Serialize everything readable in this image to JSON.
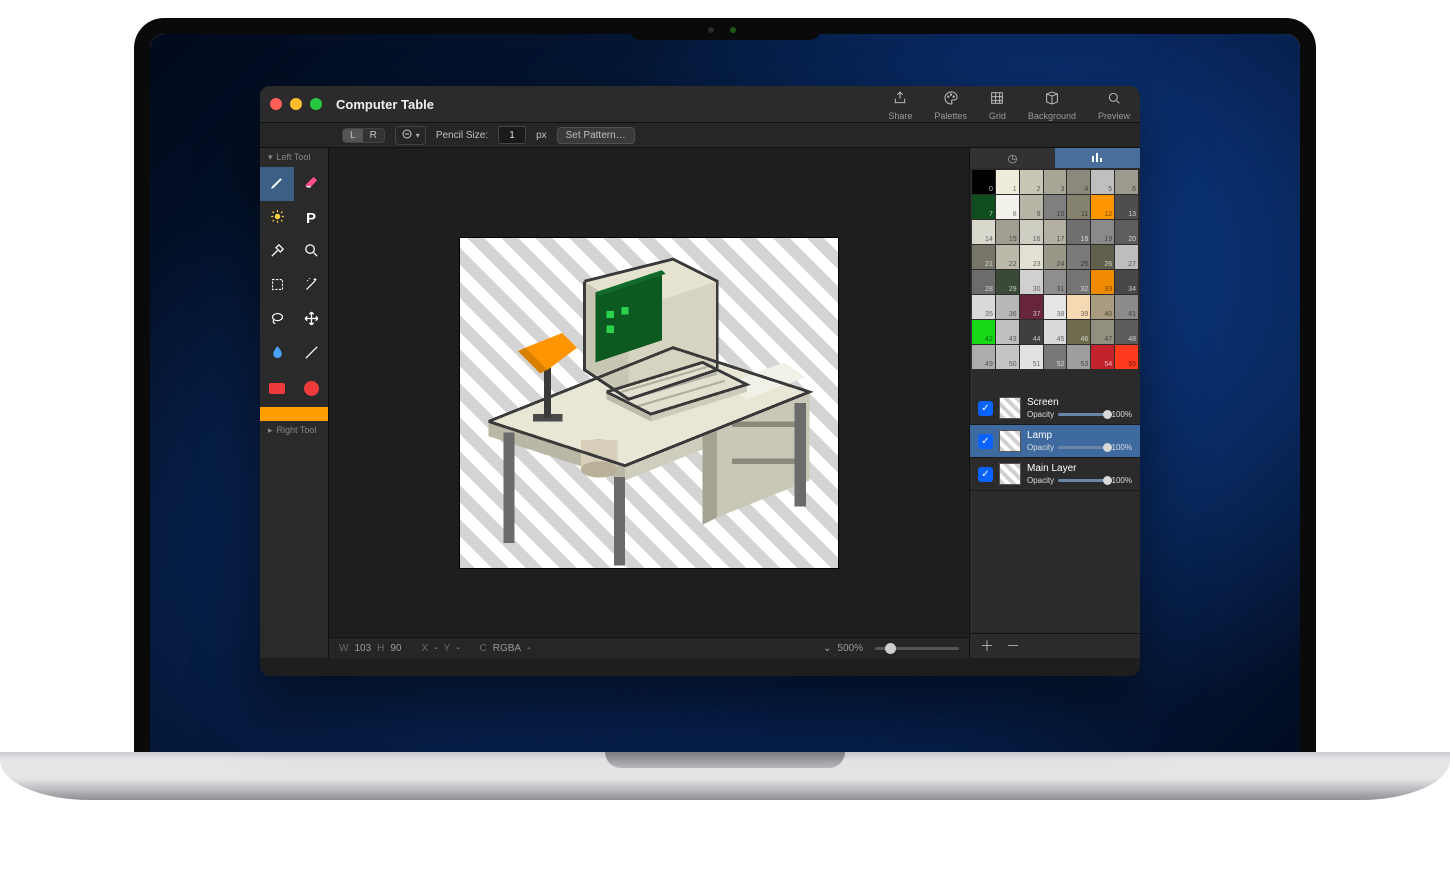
{
  "window": {
    "title": "Computer Table"
  },
  "toolbar_right": [
    {
      "label": "Share",
      "name": "share"
    },
    {
      "label": "Palettes",
      "name": "palettes"
    },
    {
      "label": "Grid",
      "name": "grid"
    },
    {
      "label": "Background",
      "name": "background"
    },
    {
      "label": "Preview",
      "name": "preview"
    }
  ],
  "tool_options": {
    "section_left": "Left Tool",
    "section_right": "Right Tool",
    "lr_left": "L",
    "lr_right": "R",
    "size_label": "Pencil Size:",
    "size_value": "1",
    "size_unit": "px",
    "pattern_btn": "Set Pattern…"
  },
  "tools": [
    {
      "name": "pencil",
      "row": 0,
      "col": 0,
      "selected": true
    },
    {
      "name": "eraser",
      "row": 0,
      "col": 1
    },
    {
      "name": "highlight",
      "row": 1,
      "col": 0
    },
    {
      "name": "text",
      "row": 1,
      "col": 1,
      "glyph": "P"
    },
    {
      "name": "eyedropper",
      "row": 2,
      "col": 0
    },
    {
      "name": "zoom",
      "row": 2,
      "col": 1
    },
    {
      "name": "rect-select",
      "row": 3,
      "col": 0
    },
    {
      "name": "magic-wand",
      "row": 3,
      "col": 1
    },
    {
      "name": "lasso",
      "row": 4,
      "col": 0
    },
    {
      "name": "move",
      "row": 4,
      "col": 1
    },
    {
      "name": "blur",
      "row": 5,
      "col": 0
    },
    {
      "name": "line",
      "row": 5,
      "col": 1
    },
    {
      "name": "fill-rect",
      "row": 6,
      "col": 0,
      "color": "#ed3a3a"
    },
    {
      "name": "fill-ellipse",
      "row": 6,
      "col": 1,
      "color": "#ed3a3a"
    }
  ],
  "primary_color": "#ff9e00",
  "palette_tabs": {
    "recent_icon": "clock",
    "stats_icon": "bars",
    "active": "stats"
  },
  "palette": [
    {
      "i": 0,
      "c": "#000000",
      "dk": 1
    },
    {
      "i": 1,
      "c": "#efedd9"
    },
    {
      "i": 2,
      "c": "#c8c7b6"
    },
    {
      "i": 3,
      "c": "#a8a697"
    },
    {
      "i": 4,
      "c": "#8b897b"
    },
    {
      "i": 5,
      "c": "#bfbfbf"
    },
    {
      "i": 6,
      "c": "#9c9a8d"
    },
    {
      "i": 7,
      "c": "#0e4e1f",
      "dk": 1
    },
    {
      "i": 8,
      "c": "#f3f2ea"
    },
    {
      "i": 9,
      "c": "#b7b5a6"
    },
    {
      "i": 10,
      "c": "#7f7f7f"
    },
    {
      "i": 11,
      "c": "#84826e"
    },
    {
      "i": 12,
      "c": "#ff9500"
    },
    {
      "i": 13,
      "c": "#4e4e4e",
      "dk": 1
    },
    {
      "i": 14,
      "c": "#d9d8cd"
    },
    {
      "i": 15,
      "c": "#a09e90"
    },
    {
      "i": 16,
      "c": "#cfcec3"
    },
    {
      "i": 17,
      "c": "#b3b0a3"
    },
    {
      "i": 18,
      "c": "#6f6f6f",
      "dk": 1
    },
    {
      "i": 19,
      "c": "#8a8a8a"
    },
    {
      "i": 20,
      "c": "#5d5d5d",
      "dk": 1
    },
    {
      "i": 21,
      "c": "#777668",
      "dk": 1
    },
    {
      "i": 22,
      "c": "#bcb9ab"
    },
    {
      "i": 23,
      "c": "#e2e0d2"
    },
    {
      "i": 24,
      "c": "#999787"
    },
    {
      "i": 25,
      "c": "#7a7a7a"
    },
    {
      "i": 26,
      "c": "#61604f",
      "dk": 1
    },
    {
      "i": 27,
      "c": "#bdbdbd"
    },
    {
      "i": 28,
      "c": "#6c6c6c",
      "dk": 1
    },
    {
      "i": 29,
      "c": "#3b4a36",
      "dk": 1
    },
    {
      "i": 30,
      "c": "#d0d0d0"
    },
    {
      "i": 31,
      "c": "#8e8e8e"
    },
    {
      "i": 32,
      "c": "#757575",
      "dk": 1
    },
    {
      "i": 33,
      "c": "#f08a00"
    },
    {
      "i": 34,
      "c": "#474747",
      "dk": 1
    },
    {
      "i": 35,
      "c": "#d9d9d9"
    },
    {
      "i": 36,
      "c": "#b7b7b7"
    },
    {
      "i": 37,
      "c": "#66253b",
      "dk": 1
    },
    {
      "i": 38,
      "c": "#e5e5e5"
    },
    {
      "i": 39,
      "c": "#f4d9b3"
    },
    {
      "i": 40,
      "c": "#a89b7f"
    },
    {
      "i": 41,
      "c": "#8b8b8b"
    },
    {
      "i": 42,
      "c": "#17d817"
    },
    {
      "i": 43,
      "c": "#bfbfbf"
    },
    {
      "i": 44,
      "c": "#3f3f3f",
      "dk": 1
    },
    {
      "i": 45,
      "c": "#dadada"
    },
    {
      "i": 46,
      "c": "#6e6b4e",
      "dk": 1
    },
    {
      "i": 47,
      "c": "#928f80"
    },
    {
      "i": 48,
      "c": "#5c5c5c",
      "dk": 1
    },
    {
      "i": 49,
      "c": "#adadad"
    },
    {
      "i": 50,
      "c": "#c5c5c5"
    },
    {
      "i": 51,
      "c": "#e2e2e2"
    },
    {
      "i": 52,
      "c": "#787878",
      "dk": 1
    },
    {
      "i": 53,
      "c": "#9e9e9e"
    },
    {
      "i": 54,
      "c": "#c2232c",
      "dk": 1
    },
    {
      "i": 55,
      "c": "#ff3b1f"
    }
  ],
  "layers": [
    {
      "name": "Screen",
      "opacity": "100%",
      "checked": true,
      "selected": false
    },
    {
      "name": "Lamp",
      "opacity": "100%",
      "checked": true,
      "selected": true
    },
    {
      "name": "Main Layer",
      "opacity": "100%",
      "checked": true,
      "selected": false
    }
  ],
  "layer_opacity_label": "Opacity",
  "status": {
    "w_label": "W",
    "w": "103",
    "h_label": "H",
    "h": "90",
    "x_label": "X",
    "x": "-",
    "y_label": "Y",
    "y": "-",
    "c_label": "C",
    "c": "RGBA",
    "c_val": "-",
    "zoom": "500%"
  }
}
